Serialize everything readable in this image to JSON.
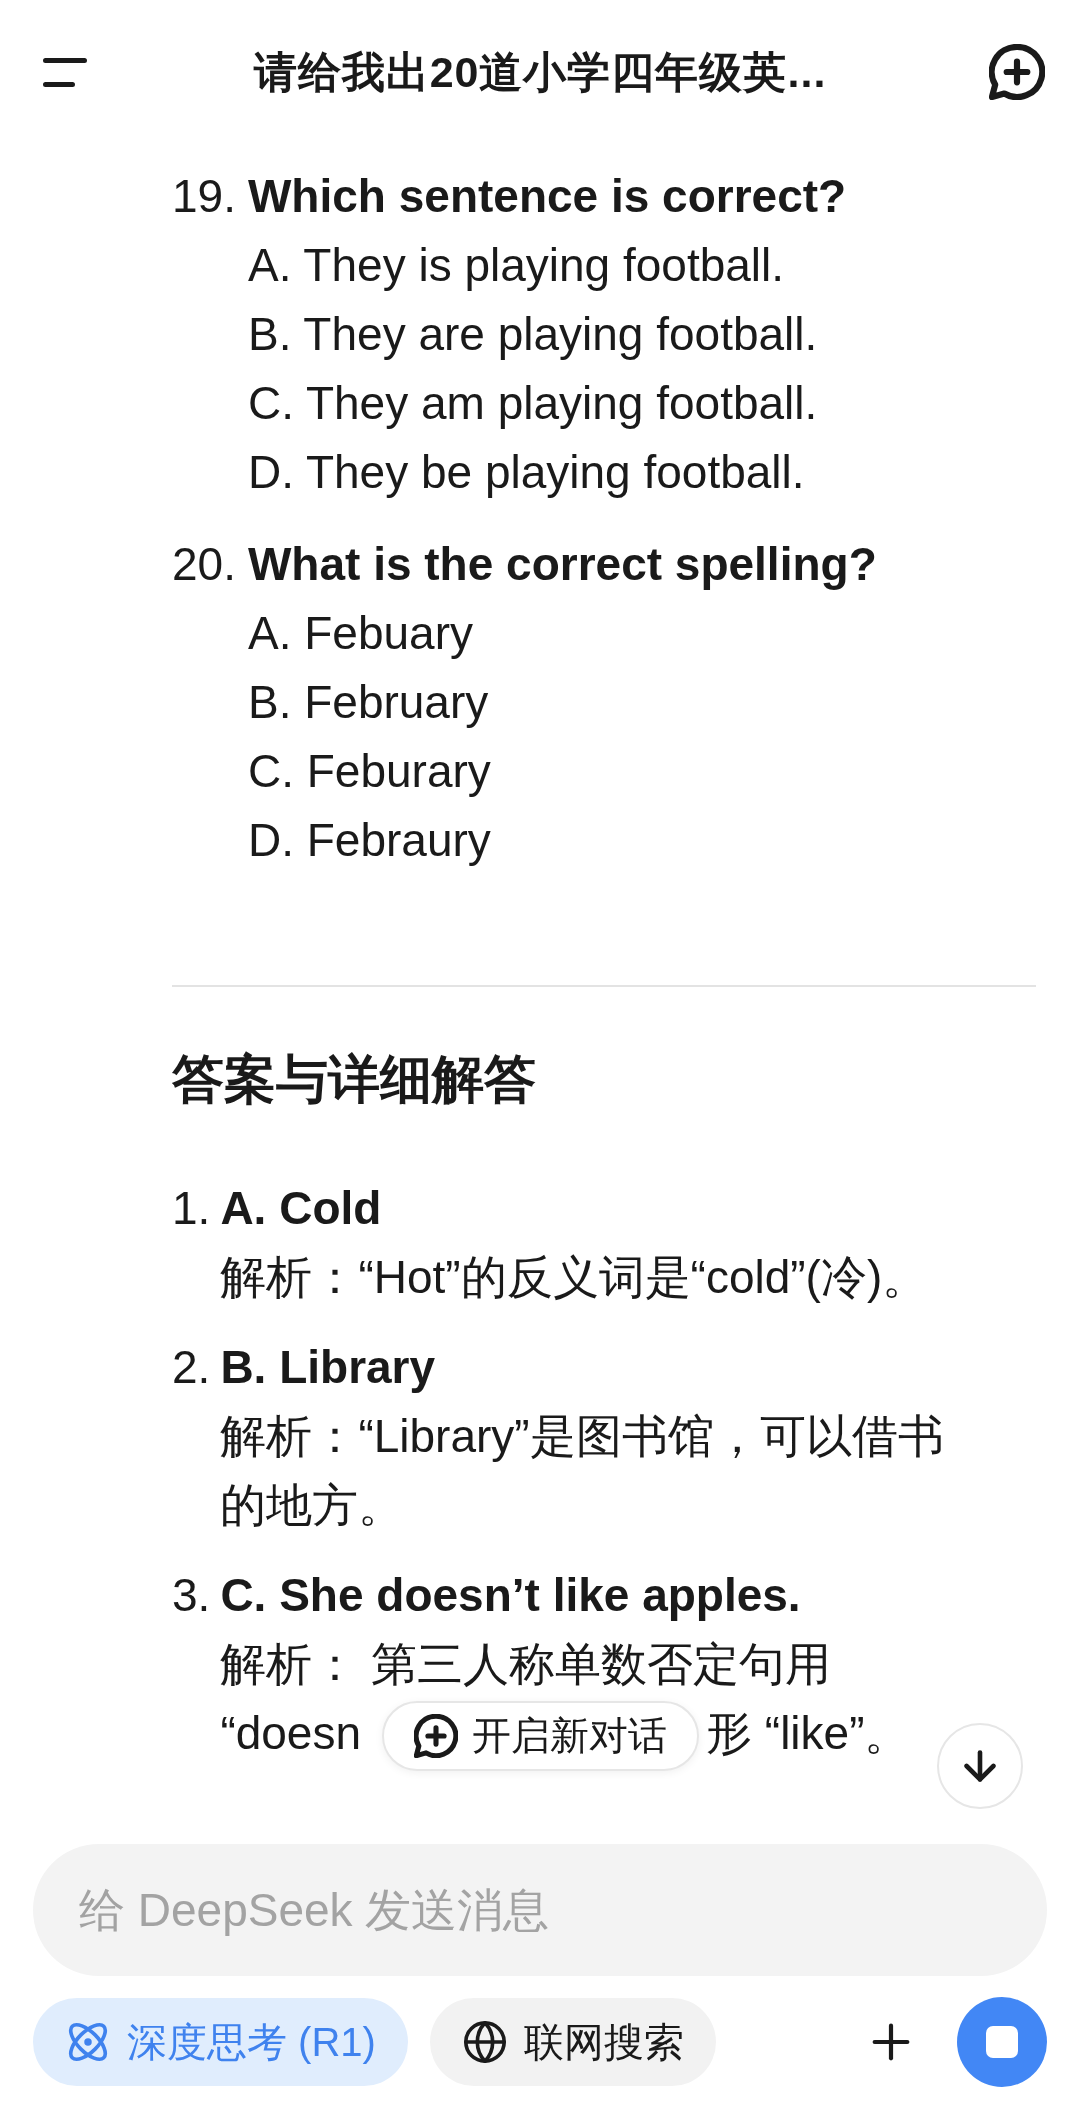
{
  "header": {
    "title": "请给我出20道小学四年级英..."
  },
  "questions": [
    {
      "number": "19.",
      "text": "Which sentence is correct?",
      "options": [
        "A. They is playing football.",
        "B. They are playing football.",
        "C. They am playing football.",
        "D. They be playing football."
      ]
    },
    {
      "number": "20.",
      "text": "What is the correct spelling?",
      "options": [
        "A. Febuary",
        "B. February",
        "C. Feburary",
        "D. Febraury"
      ]
    }
  ],
  "answers_heading": "答案与详细解答",
  "answers": [
    {
      "number": "1.",
      "answer": "A. Cold",
      "explanation": "解析：“Hot”的反义词是“cold”(冷)。"
    },
    {
      "number": "2.",
      "answer": "B. Library",
      "explanation": "解析：“Library”是图书馆，可以借书的地方。"
    },
    {
      "number": "3.",
      "answer": "C. She doesn’t like apples.",
      "explanation": "解析： 第三人称单数否定句用",
      "covered_line": [
        "“doesn",
        "形 “like”。"
      ]
    }
  ],
  "new_chat_button": {
    "label": "开启新对话"
  },
  "composer": {
    "placeholder": "给 DeepSeek 发送消息"
  },
  "toggles": [
    {
      "kind": "deep_think",
      "label": "深度思考 (R1)",
      "selected": true
    },
    {
      "kind": "web_search",
      "label": "联网搜索",
      "selected": false
    }
  ]
}
